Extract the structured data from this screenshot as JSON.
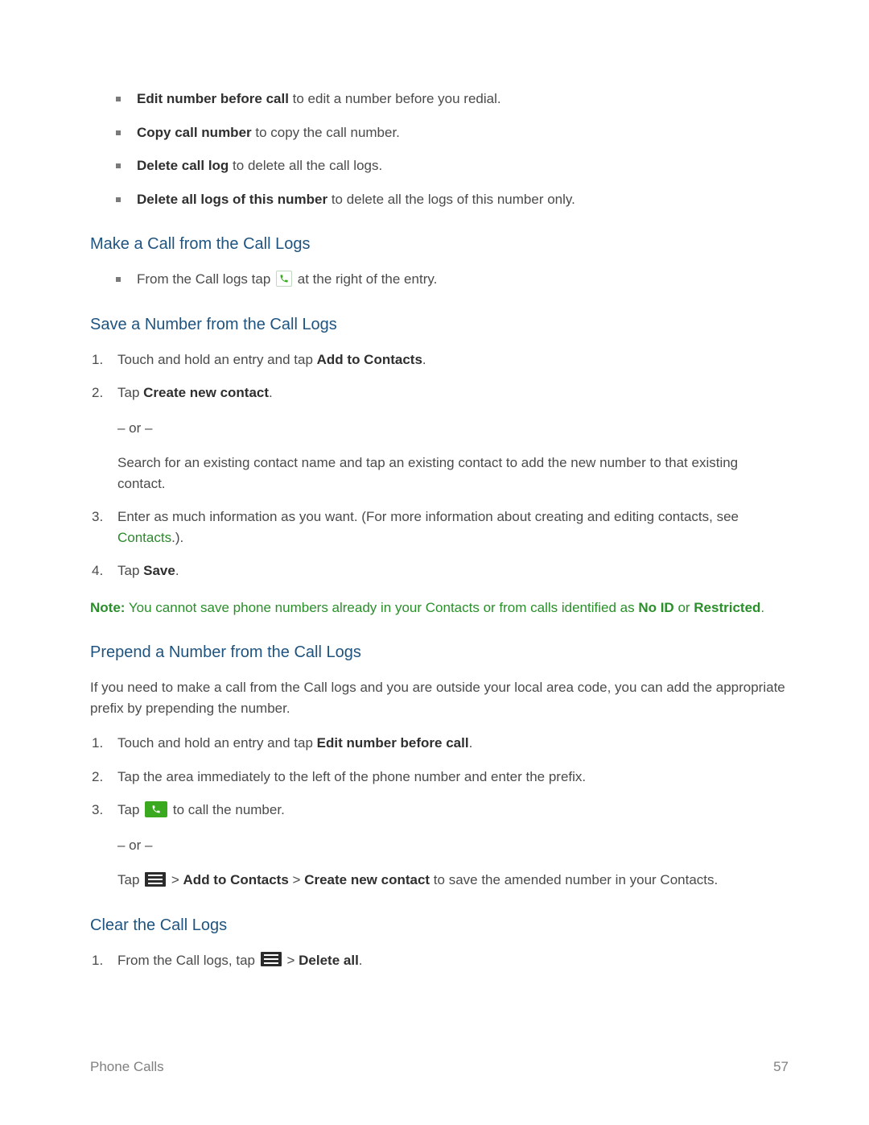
{
  "bulletOptions": [
    {
      "bold": "Edit number before call",
      "rest": " to edit a number before you redial."
    },
    {
      "bold": "Copy call number",
      "rest": " to copy the call number."
    },
    {
      "bold": "Delete call log",
      "rest": " to delete all the call logs."
    },
    {
      "bold": "Delete all logs of this number",
      "rest": " to delete all the logs of this number only."
    }
  ],
  "headings": {
    "makeCall": "Make a Call from the Call Logs",
    "saveNumber": "Save a Number from the Call Logs",
    "prepend": "Prepend a Number from the Call Logs",
    "clear": "Clear the Call Logs"
  },
  "makeCall": {
    "pre": "From the Call logs tap ",
    "post": " at the right of the entry."
  },
  "save": {
    "step1_pre": "Touch and hold an entry and tap ",
    "step1_bold": "Add to Contacts",
    "step1_post": ".",
    "step2_pre": "Tap ",
    "step2_bold": "Create new contact",
    "step2_post": ".",
    "or": "– or –",
    "or_desc": "Search for an existing contact name and tap an existing contact to add the new number to that existing contact.",
    "step3_pre": "Enter as much information as you want. (For more information about creating and editing contacts, see ",
    "step3_link": "Contacts",
    "step3_post": ".).",
    "step4_pre": "Tap ",
    "step4_bold": "Save",
    "step4_post": "."
  },
  "note": {
    "label": "Note:",
    "text1": "  You cannot save phone numbers already in your Contacts or from calls identified as ",
    "bold1": "No ID",
    "text2": " or ",
    "bold2": "Restricted",
    "text3": "."
  },
  "prepend": {
    "intro": "If you need to make a call from the Call logs and you are outside your local area code, you can add the appropriate prefix by prepending the number.",
    "step1_pre": "Touch and hold an entry and tap ",
    "step1_bold": "Edit number before call",
    "step1_post": ".",
    "step2": "Tap the area immediately to the left of the phone number and enter the prefix.",
    "step3_pre": "Tap ",
    "step3_post": " to call the number.",
    "or": "– or –",
    "alt_pre": "Tap ",
    "alt_gt1": " > ",
    "alt_bold1": "Add to Contacts",
    "alt_gt2": "  > ",
    "alt_bold2": "Create new contact",
    "alt_post": " to save the amended number in your Contacts."
  },
  "clear": {
    "step1_pre": "From the Call logs, tap ",
    "step1_gt": " > ",
    "step1_bold": "Delete all",
    "step1_post": "."
  },
  "footer": {
    "section": "Phone Calls",
    "page": "57"
  }
}
